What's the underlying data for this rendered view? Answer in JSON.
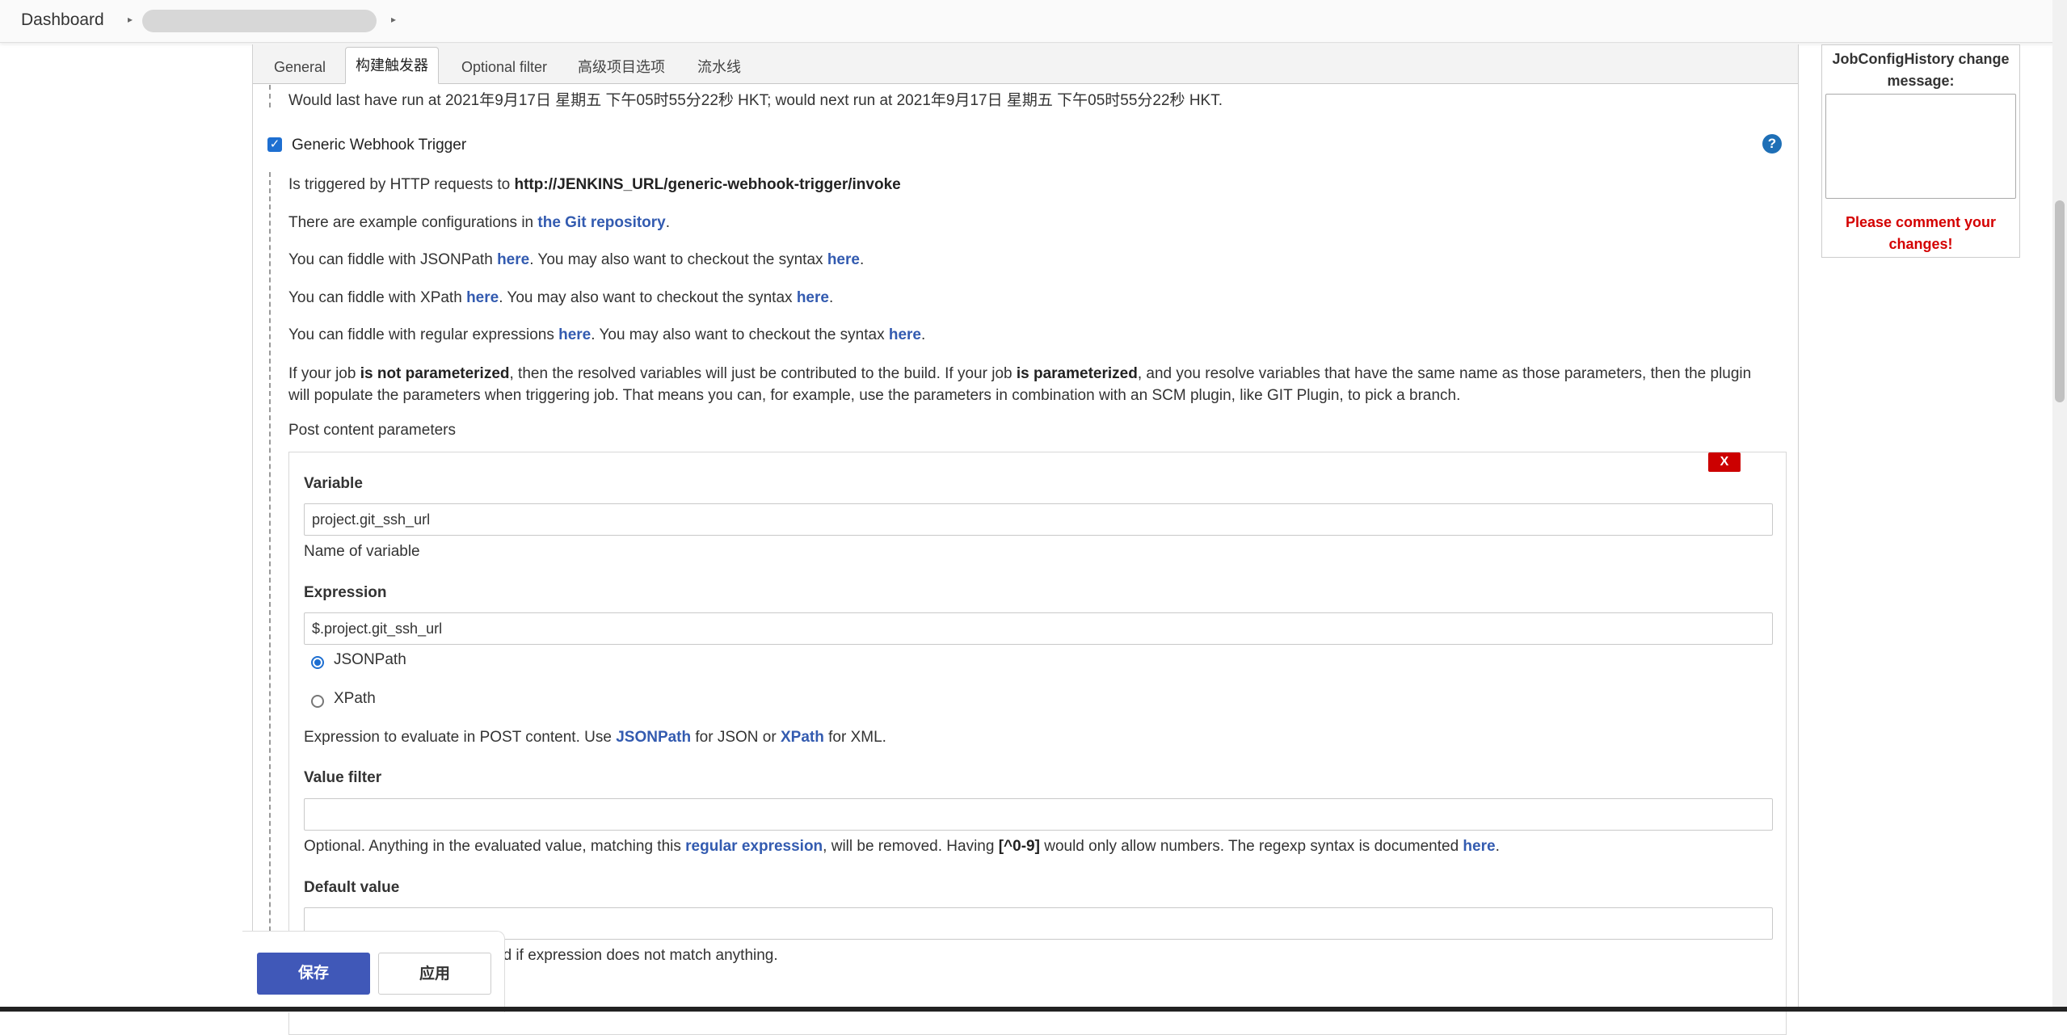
{
  "breadcrumb": {
    "dashboard": "Dashboard",
    "separator": "▸"
  },
  "tabs": [
    "General",
    "构建触发器",
    "Optional filter",
    "高级项目选项",
    "流水线"
  ],
  "schedule_note": "Would last have run at 2021年9月17日 星期五 下午05时55分22秒 HKT; would next run at 2021年9月17日 星期五 下午05时55分22秒 HKT.",
  "trigger": {
    "label": "Generic Webhook Trigger",
    "checked": true,
    "help_icon": "?",
    "intro_prefix": "Is triggered by HTTP requests to ",
    "url": "http://JENKINS_URL/generic-webhook-trigger/invoke",
    "example_prefix": "There are example configurations in ",
    "example_link": "the Git repository",
    "example_suffix": ".",
    "jsonpath_a": "You can fiddle with JSONPath ",
    "xpath_a": "You can fiddle with XPath ",
    "regex_a": "You can fiddle with regular expressions ",
    "here": "here",
    "checkout_text": ". You may also want to checkout the syntax ",
    "period": ".",
    "param_p1": "If your job ",
    "param_b1": "is not parameterized",
    "param_p2": ", then the resolved variables will just be contributed to the build. If your job ",
    "param_b2": "is parameterized",
    "param_p3": ", and you resolve variables that have the same name as those parameters, then the plugin will populate the parameters when triggering job. That means you can, for example, use the parameters in combination with an SCM plugin, like GIT Plugin, to pick a branch."
  },
  "post_params": {
    "heading": "Post content parameters",
    "delete_label": "X",
    "variable_label": "Variable",
    "variable_value": "project.git_ssh_url",
    "variable_help": "Name of variable",
    "expression_label": "Expression",
    "expression_value": "$.project.git_ssh_url",
    "radio_jsonpath": "JSONPath",
    "radio_xpath": "XPath",
    "expr_help_1": "Expression to evaluate in POST content. Use ",
    "expr_help_jsonpath": "JSONPath",
    "expr_help_2": " for JSON or ",
    "expr_help_xpath": "XPath",
    "expr_help_3": " for XML.",
    "value_filter_label": "Value filter",
    "value_filter_value": "",
    "vf_help_1": "Optional. Anything in the evaluated value, matching this ",
    "vf_help_link": "regular expression",
    "vf_help_2": ", will be removed. Having ",
    "vf_help_code": "[^0-9]",
    "vf_help_3": " would only allow numbers. The regexp syntax is documented ",
    "vf_help_here": "here",
    "vf_help_4": ".",
    "default_label": "Default value",
    "default_value": "",
    "default_help_visible": "ed if expression does not match anything."
  },
  "footer": {
    "save_label": "保存",
    "apply_label": "应用"
  },
  "history": {
    "title": "JobConfigHistory change message:",
    "warning": "Please comment your changes!"
  }
}
